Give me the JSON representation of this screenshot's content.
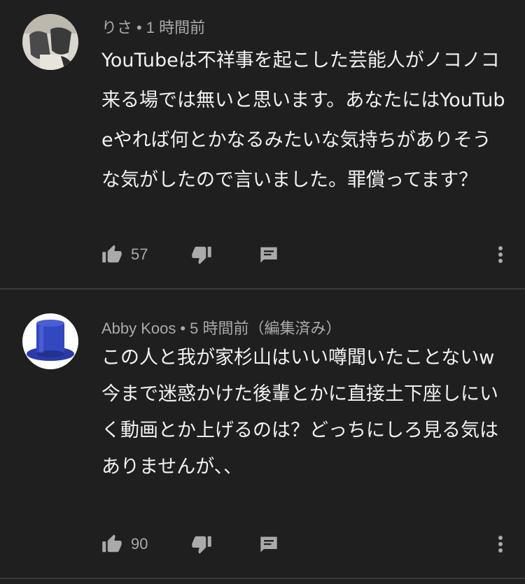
{
  "comments": [
    {
      "author": "りさ",
      "time": "1 時間前",
      "edited": "",
      "text": "YouTubeは不祥事を起こした芸能人がノコノコ来る場では無いと思います。あなたにはYouTubeやれば何とかなるみたいな気持ちがありそうな気がしたので言いました。罪償ってます？",
      "likes": "57",
      "avatar_icon": "photo-avatar-icon"
    },
    {
      "author": "Abby Koos",
      "time": "5 時間前",
      "edited": "（編集済み）",
      "text": "この人と我が家杉山はいい噂聞いたことないw\n今まで迷惑かけた後輩とかに直接土下座しにいく動画とか上げるのは？どっちにしろ見る気はありませんが、、",
      "likes": "90",
      "avatar_icon": "top-hat-icon"
    }
  ],
  "icons": {
    "like": "thumbs-up-icon",
    "dislike": "thumbs-down-icon",
    "reply": "reply-comment-icon",
    "more": "more-vertical-icon"
  },
  "colors": {
    "background": "#1f1f1f",
    "text": "#f1f1f1",
    "meta": "#aaaaaa",
    "icon": "#aaaaaa",
    "divider": "#3a3a3a"
  }
}
